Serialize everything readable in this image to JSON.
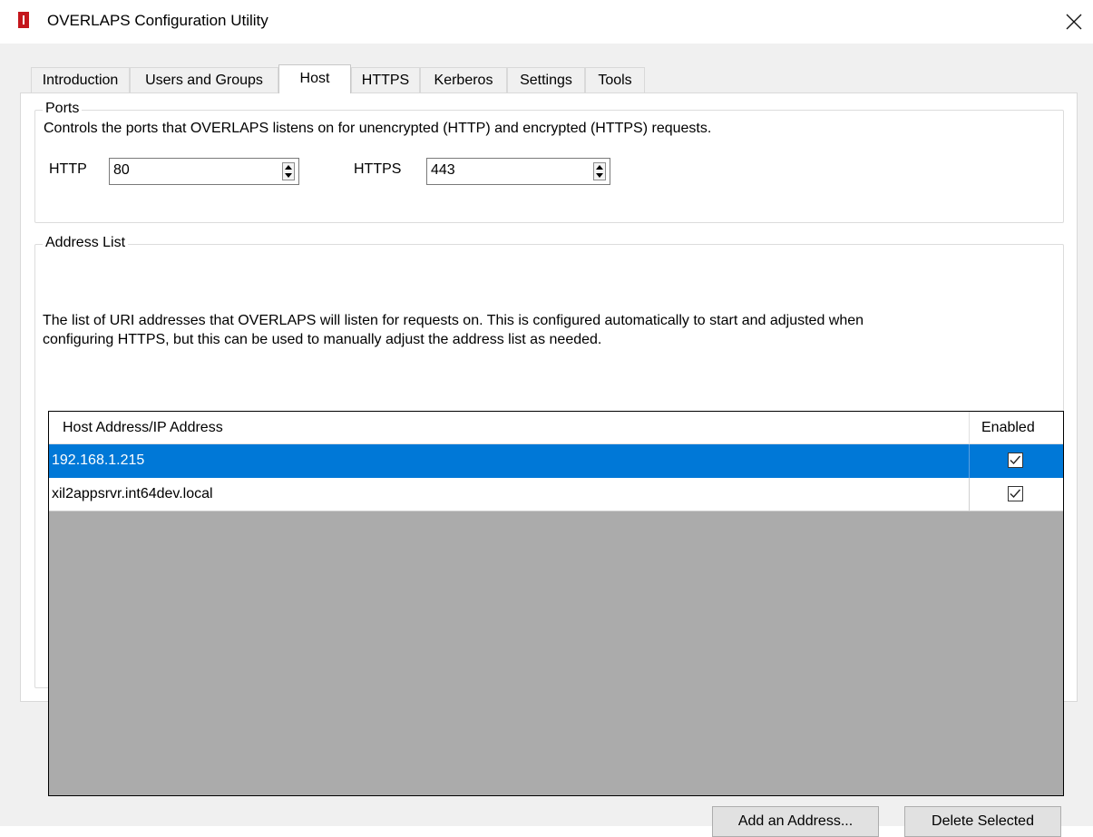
{
  "window": {
    "title": "OVERLAPS Configuration Utility"
  },
  "tabs": [
    {
      "label": "Introduction"
    },
    {
      "label": "Users and Groups"
    },
    {
      "label": "Host"
    },
    {
      "label": "HTTPS"
    },
    {
      "label": "Kerberos"
    },
    {
      "label": "Settings"
    },
    {
      "label": "Tools"
    }
  ],
  "active_tab": "Host",
  "ports": {
    "title": "Ports",
    "description": "Controls the ports that OVERLAPS listens on for unencrypted (HTTP) and encrypted (HTTPS) requests.",
    "http_label": "HTTP",
    "http_value": "80",
    "https_label": "HTTPS",
    "https_value": "443"
  },
  "address_list": {
    "title": "Address List",
    "description_line1": "The list of URI addresses that OVERLAPS will listen for requests on. This is configured automatically to start and adjusted when",
    "description_line2": "configuring HTTPS, but this can be used to manually adjust the address list as needed.",
    "columns": {
      "address": "Host Address/IP Address",
      "enabled": "Enabled"
    },
    "rows": [
      {
        "address": "192.168.1.215",
        "enabled": true,
        "selected": true
      },
      {
        "address": "xil2appsrvr.int64dev.local",
        "enabled": true,
        "selected": false
      }
    ]
  },
  "buttons": {
    "add": "Add an Address...",
    "delete": "Delete Selected"
  },
  "colors": {
    "selection": "#0078d7",
    "grid_background": "#ababab",
    "app_icon": "#c4161c"
  },
  "icons": {
    "app": "app-icon",
    "close": "close-icon",
    "checkbox": "check-icon"
  }
}
